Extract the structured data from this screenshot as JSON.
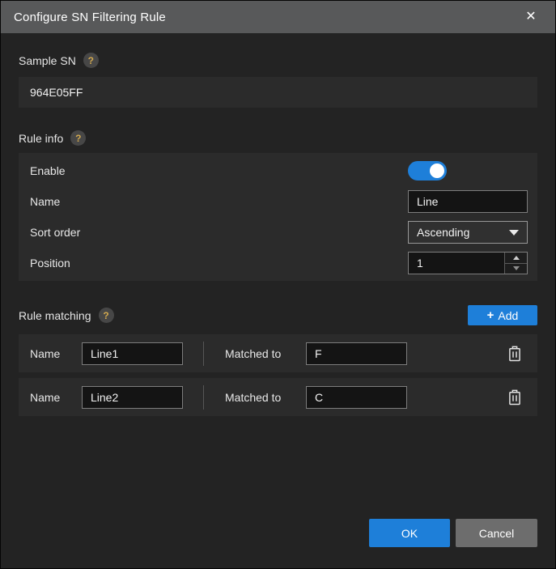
{
  "window": {
    "title": "Configure SN Filtering Rule",
    "close_icon": "✕"
  },
  "sample_sn": {
    "label": "Sample SN",
    "help_icon": "?",
    "value": "964E05FF"
  },
  "rule_info": {
    "label": "Rule info",
    "help_icon": "?",
    "enable": {
      "label": "Enable",
      "state": "on"
    },
    "name": {
      "label": "Name",
      "value": "Line"
    },
    "sort_order": {
      "label": "Sort order",
      "value": "Ascending"
    },
    "position": {
      "label": "Position",
      "value": "1"
    }
  },
  "rule_matching": {
    "label": "Rule matching",
    "help_icon": "?",
    "add_button": {
      "icon": "+",
      "label": "Add"
    },
    "rows": [
      {
        "name_label": "Name",
        "name_value": "Line1",
        "matched_label": "Matched to",
        "matched_value": "F"
      },
      {
        "name_label": "Name",
        "name_value": "Line2",
        "matched_label": "Matched to",
        "matched_value": "C"
      }
    ]
  },
  "footer": {
    "ok_label": "OK",
    "cancel_label": "Cancel"
  },
  "colors": {
    "accent_blue": "#1e7fd9",
    "cancel_gray": "#6d6d6d",
    "titlebar_gray": "#58595a",
    "panel_gray": "#2b2b2b",
    "help_amber": "#d2a94f"
  }
}
